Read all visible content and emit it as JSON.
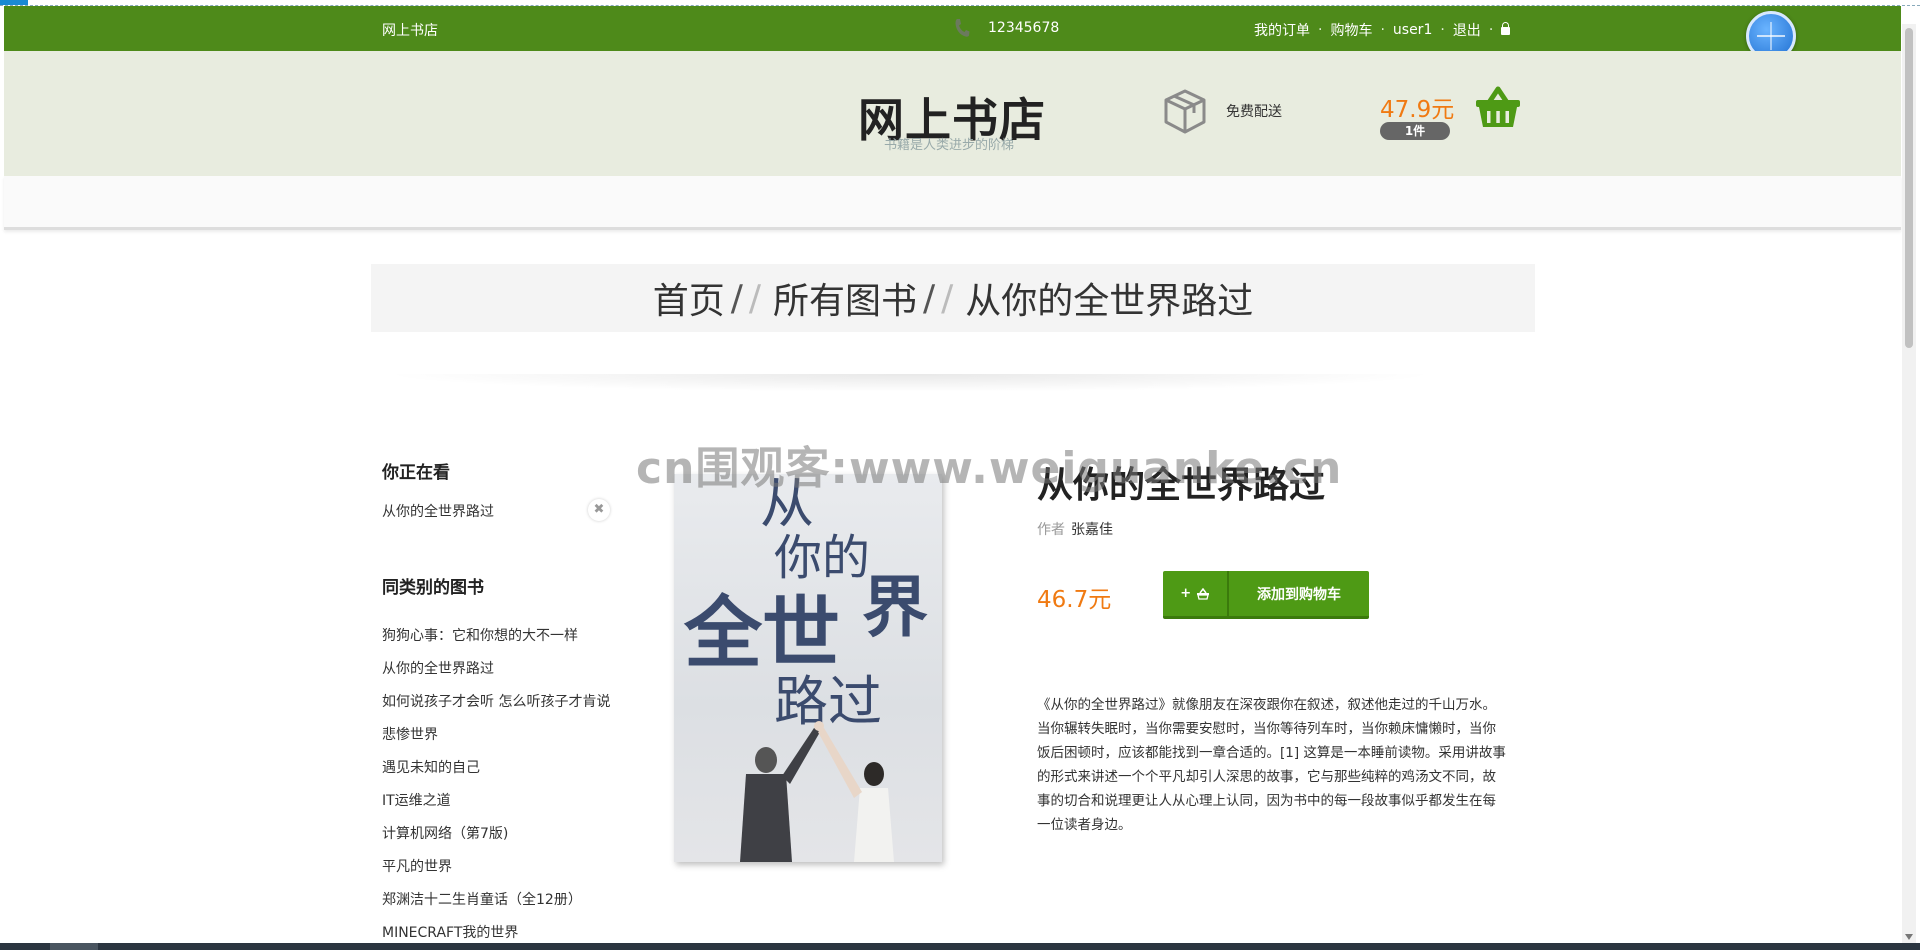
{
  "topbar": {
    "brand": "网上书店",
    "phone": "12345678",
    "links": [
      "我的订单",
      "购物车",
      "user1",
      "退出"
    ],
    "sep": "·",
    "bg_color": "#4e8a1a"
  },
  "header": {
    "logo_title": "网上书店",
    "logo_subtitle": "书籍是人类进步的阶梯",
    "shipping_icon": "box-icon",
    "shipping_text": "免费配送",
    "cart_total": "47.9元",
    "cart_count": "1件",
    "cart_icon": "basket-icon",
    "bg_color": "#e8ecdf"
  },
  "breadcrumb": {
    "items": [
      "首页",
      "所有图书",
      "从你的全世界路过"
    ]
  },
  "sidebar": {
    "viewing_heading": "你正在看",
    "viewing_item": "从你的全世界路过",
    "related_heading": "同类别的图书",
    "related_items": [
      "狗狗心事：它和你想的大不一样",
      "从你的全世界路过",
      "如何说孩子才会听 怎么听孩子才肯说",
      "悲惨世界",
      "遇见未知的自己",
      "IT运维之道",
      "计算机网络（第7版)",
      "平凡的世界",
      "郑渊洁十二生肖童话（全12册）",
      "MINECRAFT我的世界"
    ]
  },
  "product": {
    "cover_text": [
      "从",
      "你的",
      "全世",
      "界",
      "路过"
    ],
    "title": "从你的全世界路过",
    "author_label": "作者",
    "author": "张嘉佳",
    "price": "46.7元",
    "add_button_plus": "+",
    "add_button_label": "添加到购物车",
    "price_color": "#f07a12",
    "button_color": "#4e9a15",
    "description": "《从你的全世界路过》就像朋友在深夜跟你在叙述，叙述他走过的千山万水。当你辗转失眠时，当你需要安慰时，当你等待列车时，当你赖床慵懒时，当你饭后困顿时，应该都能找到一章合适的。[1] 这算是一本睡前读物。采用讲故事的形式来讲述一个个平凡却引人深思的故事，它与那些纯粹的鸡汤文不同，故事的切合和说理更让人从心理上认同，因为书中的每一段故事似乎都发生在每一位读者身边。"
  },
  "watermark": "cn围观客:www.weiguanke.cn"
}
